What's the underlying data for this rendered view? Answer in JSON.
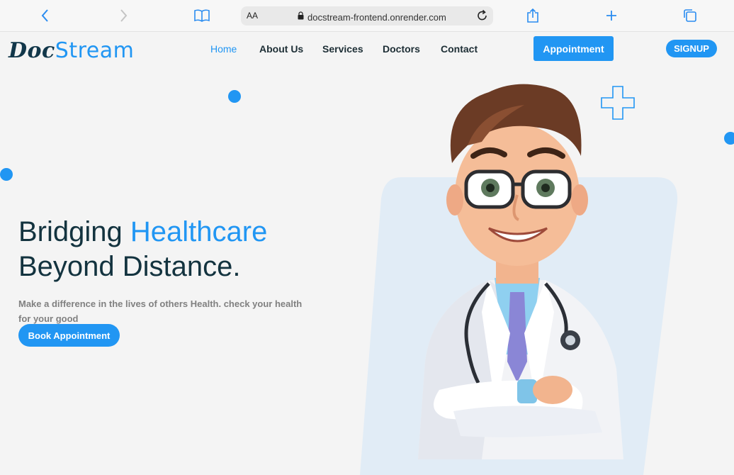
{
  "browser": {
    "reader_label": "AA",
    "url": "docstream-frontend.onrender.com",
    "icons": [
      "back-icon",
      "forward-icon",
      "book-icon",
      "lock-icon",
      "reload-icon",
      "share-icon",
      "new-tab-icon",
      "tabs-icon"
    ]
  },
  "site": {
    "logo_part1": "Doc",
    "logo_part2": "Stream",
    "nav": [
      "Home",
      "About Us",
      "Services",
      "Doctors",
      "Contact"
    ],
    "active_nav": "Home",
    "appointment_label": "Appointment",
    "signup_label": "SIGNUP"
  },
  "hero": {
    "title_part1": "Bridging ",
    "title_highlight": "Healthcare",
    "title_line2": "Beyond Distance.",
    "subtitle": "Make a difference in the lives of others Health. check your health for your good",
    "cta_label": "Book Appointment"
  },
  "colors": {
    "accent": "#2196f3",
    "heading": "#13333f",
    "background": "#f4f4f4",
    "card": "#e1ecf6"
  }
}
